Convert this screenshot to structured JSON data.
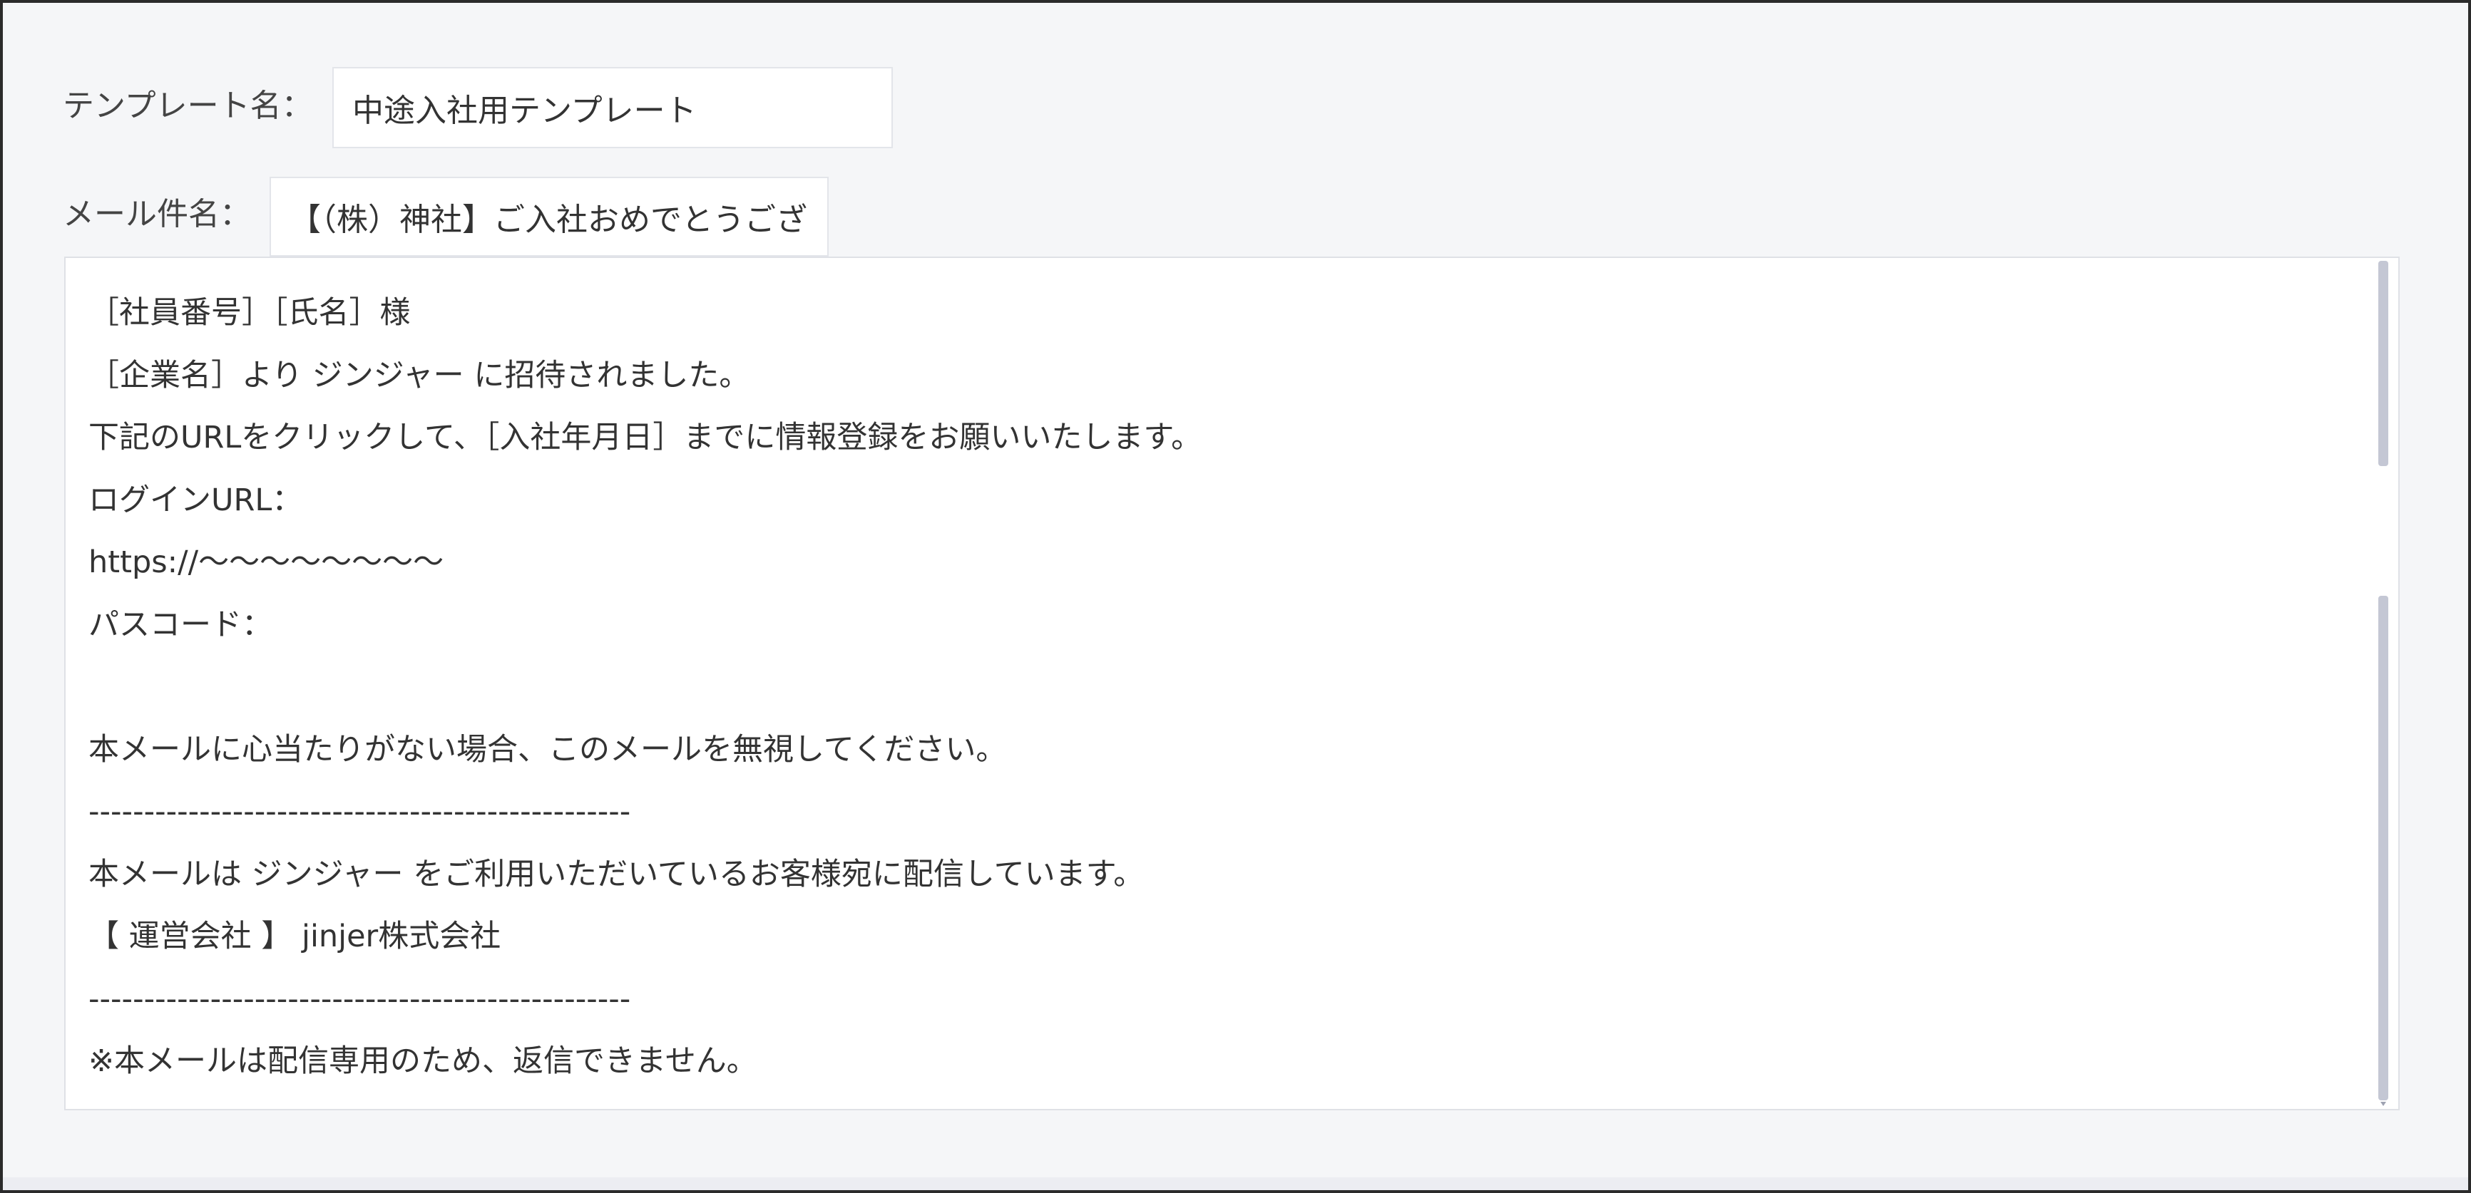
{
  "form": {
    "template_name_label": "テンプレート名：",
    "template_name_value": "中途入社用テンプレート",
    "mail_subject_label": "メール件名：",
    "mail_subject_value": "【（株）神社】ご入社おめでとうございます"
  },
  "mail_body": {
    "lines": [
      "［社員番号］［氏名］様",
      "［企業名］より ジンジャー に招待されました。",
      "下記のURLをクリックして、［入社年月日］までに情報登録をお願いいたします。",
      "ログインURL：",
      "https://〜〜〜〜〜〜〜〜",
      "パスコード：",
      "",
      "本メールに心当たりがない場合、このメールを無視してください。",
      "-------------------------------------------------",
      "本メールは ジンジャー をご利用いただいているお客様宛に配信しています。",
      "【 運営会社 】 jinjer株式会社",
      "-------------------------------------------------",
      "※本メールは配信専用のため、返信できません。"
    ]
  }
}
